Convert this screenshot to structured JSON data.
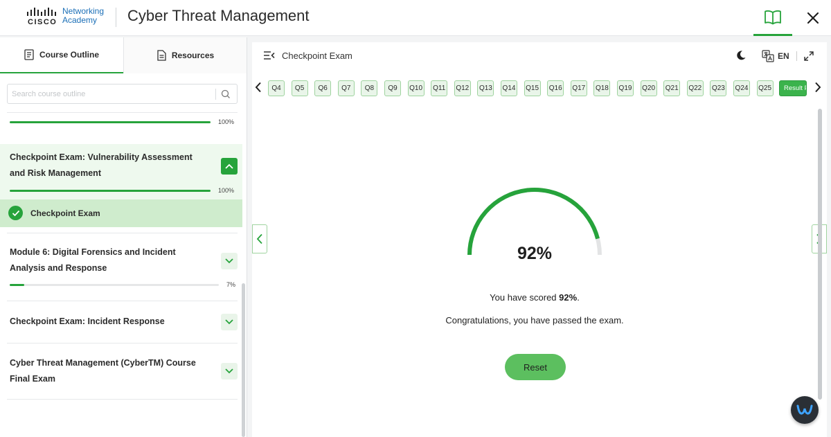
{
  "header": {
    "logo_cisco": "CISCO",
    "logo_line1": "Networking",
    "logo_line2": "Academy",
    "app_title": "Cyber Threat Management"
  },
  "sidebar": {
    "tabs": [
      {
        "label": "Course Outline",
        "icon": "outline-icon"
      },
      {
        "label": "Resources",
        "icon": "document-icon"
      }
    ],
    "search_placeholder": "Search course outline",
    "top_progress": {
      "percent_label": "100%",
      "value": 1.0
    },
    "sections": [
      {
        "title_line1": "Checkpoint Exam: Vulnerability Assessment",
        "title_line2": "and Risk Management",
        "percent_label": "100%",
        "value": 1.0,
        "expanded": true
      },
      {
        "title_line1": "Module 6: Digital Forensics and Incident",
        "title_line2": "Analysis and Response",
        "percent_label": "7%",
        "value": 0.07,
        "expanded": false
      },
      {
        "title_line1": "Checkpoint Exam: Incident Response",
        "expanded": false
      },
      {
        "title_line1": "Cyber Threat Management (CyberTM) Course",
        "title_line2": "Final Exam",
        "expanded": false
      }
    ],
    "active_item": "Checkpoint Exam"
  },
  "main": {
    "title": "Checkpoint Exam",
    "language": "EN",
    "questions": [
      "Q4",
      "Q5",
      "Q6",
      "Q7",
      "Q8",
      "Q9",
      "Q10",
      "Q11",
      "Q12",
      "Q13",
      "Q14",
      "Q15",
      "Q16",
      "Q17",
      "Q18",
      "Q19",
      "Q20",
      "Q21",
      "Q22",
      "Q23",
      "Q24",
      "Q25"
    ],
    "result_tab": "Result Page",
    "score_value": 0.92,
    "score_display": "92%",
    "score_text_prefix": "You have scored ",
    "score_text_suffix": ".",
    "congrats": "Congratulations, you have passed the exam.",
    "reset_label": "Reset"
  },
  "colors": {
    "accent": "#26a33b",
    "reset_button": "#5cbf5f",
    "active_section_bg": "#eef9ee",
    "active_item_bg": "#cfeccd"
  }
}
